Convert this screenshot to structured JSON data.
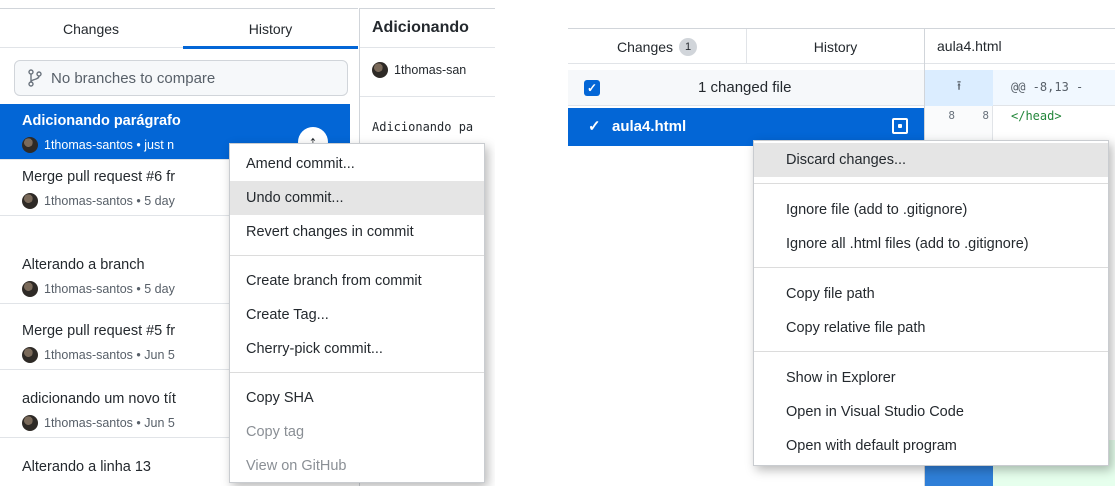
{
  "left": {
    "tabs": {
      "changes": "Changes",
      "history": "History"
    },
    "branch_compare_placeholder": "No branches to compare",
    "commits": [
      {
        "title": "Adicionando parágrafo",
        "meta": "1thomas-santos • just n"
      },
      {
        "title": "Merge pull request #6 fr",
        "meta": "1thomas-santos • 5 day"
      },
      {
        "title": "Alterando a branch",
        "meta": "1thomas-santos • 5 day"
      },
      {
        "title": "Merge pull request #5 fr",
        "meta": "1thomas-santos • Jun 5"
      },
      {
        "title": "adicionando um novo tít",
        "meta": "1thomas-santos • Jun 5"
      },
      {
        "title": "Alterando a linha 13",
        "meta": ""
      }
    ],
    "diff": {
      "title": "Adicionando",
      "author": "1thomas-san",
      "message": "Adicionando pa"
    },
    "context_menu": {
      "amend": "Amend commit...",
      "undo": "Undo commit...",
      "revert": "Revert changes in commit",
      "create_branch": "Create branch from commit",
      "create_tag": "Create Tag...",
      "cherry_pick": "Cherry-pick commit...",
      "copy_sha": "Copy SHA",
      "copy_tag": "Copy tag",
      "view_on_github": "View on GitHub"
    }
  },
  "right": {
    "tabs": {
      "changes": "Changes",
      "changes_count": "1",
      "history": "History"
    },
    "file_tab": "aula4.html",
    "changed_files_label": "1 changed file",
    "file_name": "aula4.html",
    "hunk_arrow": "⭱",
    "hunk_header": "@@ -8,13 -",
    "diff_line": {
      "old": "8",
      "new": "8",
      "code": "</head>"
    },
    "context_menu": {
      "discard": "Discard changes...",
      "ignore_file": "Ignore file (add to .gitignore)",
      "ignore_all": "Ignore all .html files (add to .gitignore)",
      "copy_path": "Copy file path",
      "copy_relative": "Copy relative file path",
      "show_explorer": "Show in Explorer",
      "open_vscode": "Open in Visual Studio Code",
      "open_default": "Open with default program"
    }
  },
  "colors": {
    "accent": "#0366d6",
    "menu_hover": "#e5e5e5",
    "border": "#d1d5da"
  }
}
